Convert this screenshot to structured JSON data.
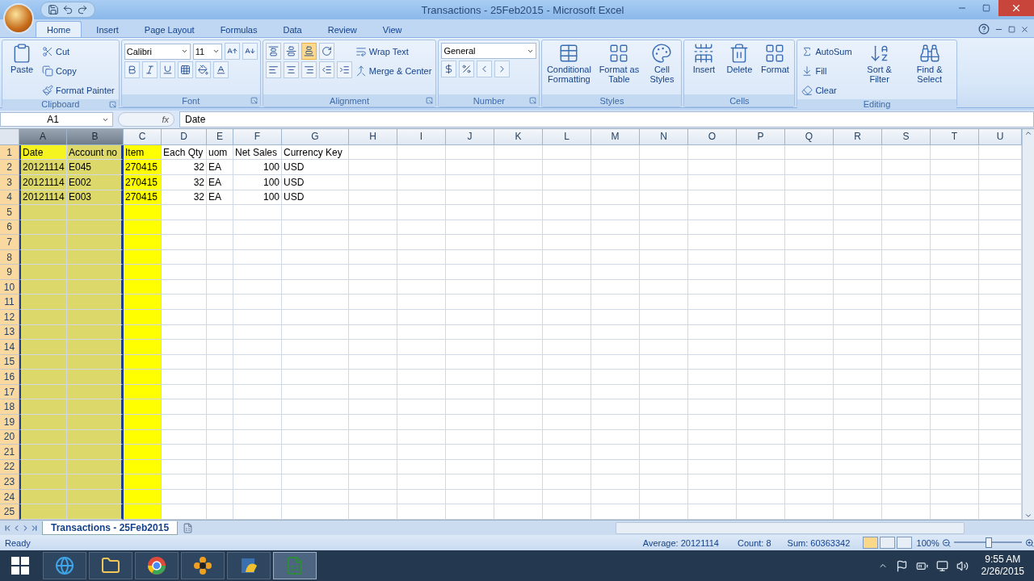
{
  "window": {
    "title": "Transactions - 25Feb2015 - Microsoft Excel"
  },
  "tabs": [
    {
      "label": "Home",
      "selected": true
    },
    {
      "label": "Insert",
      "selected": false
    },
    {
      "label": "Page Layout",
      "selected": false
    },
    {
      "label": "Formulas",
      "selected": false
    },
    {
      "label": "Data",
      "selected": false
    },
    {
      "label": "Review",
      "selected": false
    },
    {
      "label": "View",
      "selected": false
    }
  ],
  "ribbon": {
    "groups": [
      {
        "label": "Clipboard",
        "launcher": true,
        "columns": [
          [
            [
              {
                "kind": "large",
                "label": "Paste"
              }
            ]
          ],
          [
            [
              {
                "kind": "small",
                "label": "Cut"
              }
            ],
            [
              {
                "kind": "small",
                "label": "Copy"
              }
            ],
            [
              {
                "kind": "small",
                "label": "Format Painter"
              }
            ]
          ]
        ]
      },
      {
        "label": "Font",
        "launcher": true,
        "columns": [
          [
            [
              {
                "kind": "combo",
                "value": "Calibri"
              },
              {
                "kind": "combo",
                "value": "11"
              },
              {
                "kind": "sizing"
              }
            ],
            [
              {
                "kind": "formatting"
              }
            ]
          ]
        ]
      },
      {
        "label": "Alignment",
        "launcher": true,
        "columns": [
          [
            [
              {
                "kind": "vertical"
              }
            ],
            [
              {
                "kind": "horizontal"
              }
            ]
          ],
          [
            [
              {
                "kind": "small",
                "label": "Wrap Text"
              }
            ],
            [
              {
                "kind": "small",
                "label": "Merge & Center"
              }
            ]
          ]
        ]
      },
      {
        "label": "Number",
        "launcher": true,
        "columns": [
          [
            [
              {
                "kind": "combo",
                "value": "General"
              }
            ],
            [
              {
                "kind": "numeric"
              }
            ]
          ]
        ]
      },
      {
        "label": "Styles",
        "launcher": false,
        "columns": [
          [
            [
              {
                "kind": "large",
                "label": "Conditional Formatting"
              }
            ]
          ],
          [
            [
              {
                "kind": "large",
                "label": "Format as Table"
              }
            ]
          ],
          [
            [
              {
                "kind": "large",
                "label": "Cell Styles"
              }
            ]
          ]
        ]
      },
      {
        "label": "Cells",
        "launcher": false,
        "columns": [
          [
            [
              {
                "kind": "large",
                "label": "Insert"
              }
            ]
          ],
          [
            [
              {
                "kind": "large",
                "label": "Delete"
              }
            ]
          ],
          [
            [
              {
                "kind": "large",
                "label": "Format"
              }
            ]
          ]
        ]
      },
      {
        "label": "Editing",
        "launcher": false,
        "columns": [
          [
            [
              {
                "kind": "small",
                "label": "AutoSum"
              }
            ],
            [
              {
                "kind": "small",
                "label": "Fill"
              }
            ],
            [
              {
                "kind": "small",
                "label": "Clear"
              }
            ]
          ],
          [
            [
              {
                "kind": "large",
                "label": "Sort & Filter"
              }
            ]
          ],
          [
            [
              {
                "kind": "large",
                "label": "Find & Select"
              }
            ]
          ]
        ]
      }
    ]
  },
  "formula_bar": {
    "name_box": "A1",
    "function_button": "fx",
    "formula": "Date"
  },
  "sheet": {
    "columns": [
      {
        "letter": "A",
        "selected": true,
        "color": "#dcd86a"
      },
      {
        "letter": "B",
        "selected": true,
        "color": "#dcd86a"
      },
      {
        "letter": "C",
        "selected": false,
        "color": "#ffff00"
      },
      {
        "letter": "D",
        "selected": false
      },
      {
        "letter": "E",
        "selected": false
      },
      {
        "letter": "F",
        "selected": false
      },
      {
        "letter": "G",
        "selected": false
      },
      {
        "letter": "H",
        "selected": false
      },
      {
        "letter": "I",
        "selected": false
      },
      {
        "letter": "J",
        "selected": false
      },
      {
        "letter": "K",
        "selected": false
      },
      {
        "letter": "L",
        "selected": false
      },
      {
        "letter": "M",
        "selected": false
      },
      {
        "letter": "N",
        "selected": false
      },
      {
        "letter": "O",
        "selected": false
      },
      {
        "letter": "P",
        "selected": false
      },
      {
        "letter": "Q",
        "selected": false
      },
      {
        "letter": "R",
        "selected": false
      },
      {
        "letter": "S",
        "selected": false
      },
      {
        "letter": "T",
        "selected": false
      },
      {
        "letter": "U",
        "selected": false
      }
    ],
    "rows": [
      {
        "header": "1",
        "cells": [
          {
            "text": "Date",
            "active": true
          },
          {
            "text": "Account no"
          },
          {
            "text": "Item"
          },
          {
            "text": "Each Qty"
          },
          {
            "text": "uom"
          },
          {
            "text": "Net Sales"
          },
          {
            "text": "Currency Key"
          }
        ]
      },
      {
        "header": "2",
        "cells": [
          {
            "text": "20121114"
          },
          {
            "text": "E045"
          },
          {
            "text": "270415"
          },
          {
            "text": "32",
            "right_aligned": true
          },
          {
            "text": "EA"
          },
          {
            "text": "100",
            "right_aligned": true
          },
          {
            "text": "USD"
          }
        ]
      },
      {
        "header": "3",
        "cells": [
          {
            "text": "20121114"
          },
          {
            "text": "E002"
          },
          {
            "text": "270415"
          },
          {
            "text": "32",
            "right_aligned": true
          },
          {
            "text": "EA"
          },
          {
            "text": "100",
            "right_aligned": true
          },
          {
            "text": "USD"
          }
        ]
      },
      {
        "header": "4",
        "cells": [
          {
            "text": "20121114"
          },
          {
            "text": "E003"
          },
          {
            "text": "270415"
          },
          {
            "text": "32",
            "right_aligned": true
          },
          {
            "text": "EA"
          },
          {
            "text": "100",
            "right_aligned": true
          },
          {
            "text": "USD"
          }
        ]
      },
      {
        "header": "5"
      },
      {
        "header": "6"
      },
      {
        "header": "7"
      },
      {
        "header": "8"
      },
      {
        "header": "9"
      },
      {
        "header": "10"
      },
      {
        "header": "11"
      },
      {
        "header": "12"
      },
      {
        "header": "13"
      },
      {
        "header": "14"
      },
      {
        "header": "15"
      },
      {
        "header": "16"
      },
      {
        "header": "17"
      },
      {
        "header": "18"
      },
      {
        "header": "19"
      },
      {
        "header": "20"
      },
      {
        "header": "21"
      },
      {
        "header": "22"
      },
      {
        "header": "23"
      },
      {
        "header": "24"
      },
      {
        "header": "25"
      }
    ],
    "tabs": [
      {
        "label": "Transactions - 25Feb2015",
        "selected": true
      }
    ]
  },
  "status_bar": {
    "mode": "Ready",
    "average": "Average: 20121114",
    "count": "Count: 8",
    "sum": "Sum: 60363342",
    "zoom": "100%",
    "zoom_level": {
      "level": 0.5
    }
  },
  "taskbar": {
    "apps": [
      {
        "selected": false
      },
      {
        "selected": false
      },
      {
        "selected": false
      },
      {
        "selected": false
      },
      {
        "selected": false
      },
      {
        "selected": true
      }
    ],
    "time": "9:55 AM",
    "date": "2/26/2015"
  }
}
